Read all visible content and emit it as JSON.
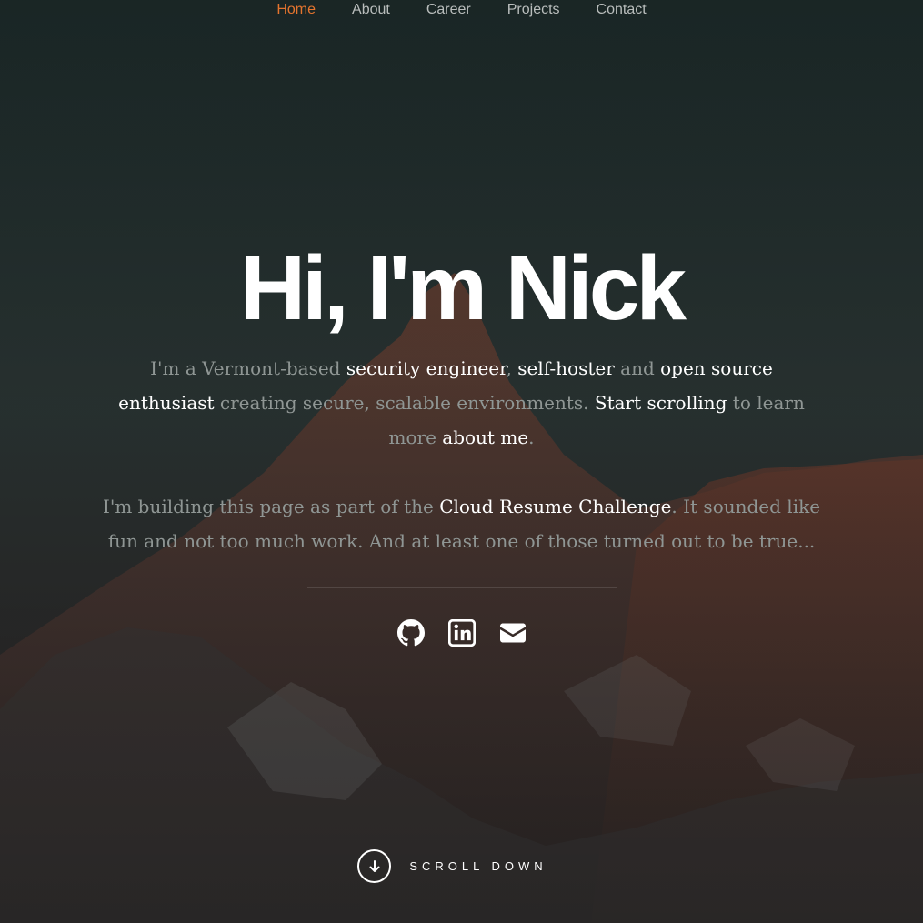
{
  "nav": {
    "items": [
      {
        "label": "Home",
        "active": true
      },
      {
        "label": "About",
        "active": false
      },
      {
        "label": "Career",
        "active": false
      },
      {
        "label": "Projects",
        "active": false
      },
      {
        "label": "Contact",
        "active": false
      }
    ]
  },
  "hero": {
    "title": "Hi, I'm Nick",
    "lead": {
      "t1": "I'm a Vermont-based ",
      "security_engineer": "security engineer",
      "t2": ", ",
      "self_hoster": "self-hoster",
      "t3": " and ",
      "oss": "open source enthusiast",
      "t4": " creating secure, scalable environments. ",
      "start_scrolling": "Start scrolling",
      "t5": " to learn more ",
      "about_me": "about me",
      "t6": "."
    },
    "lead2": {
      "t1": "I'm building this page as part of the ",
      "crc": "Cloud Resume Challenge",
      "t2": ". It sounded like fun and not too much work. And at least one of those turned out to be true..."
    },
    "socials": [
      "github-icon",
      "linkedin-icon",
      "envelope-icon"
    ],
    "scroll_label": "SCROLL DOWN"
  },
  "colors": {
    "accent": "#e5742e",
    "nav_text": "#b9bdbc",
    "muted_text": "#8f9694",
    "highlight_text": "#ffffff"
  }
}
